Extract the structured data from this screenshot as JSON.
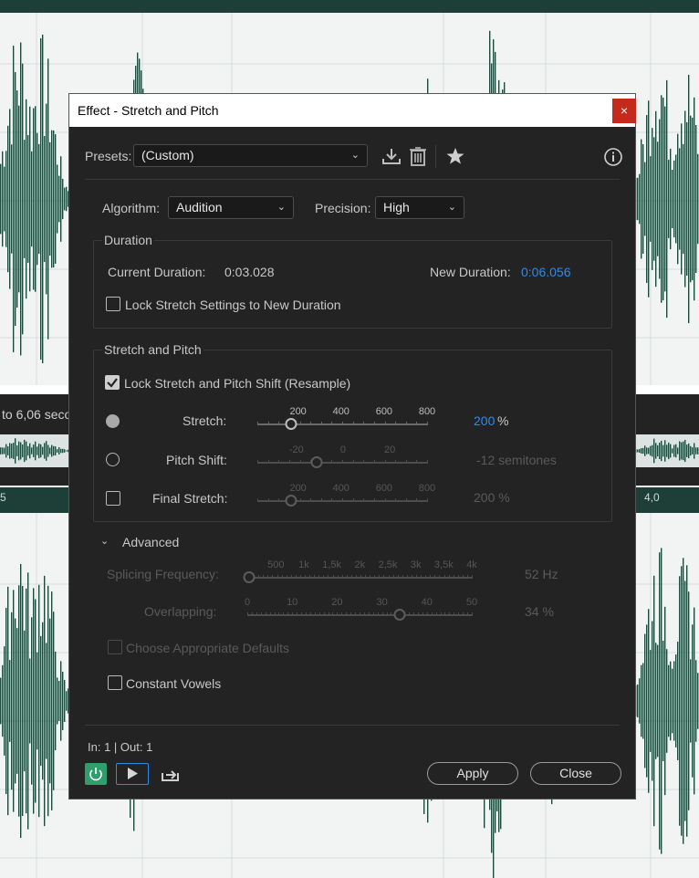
{
  "background": {
    "left_time_label": "to 6,06 seco",
    "ruler_left": "5",
    "ruler_right": "4,0",
    "colors": {
      "waveform": "#1e4a3e",
      "ruler": "#1d3f37"
    }
  },
  "dialog": {
    "title": "Effect - Stretch and Pitch",
    "close_glyph": "×",
    "presets": {
      "label": "Presets:",
      "value": "(Custom)"
    },
    "toolbar_icons": [
      "download-icon",
      "trash-icon",
      "star-icon",
      "info-icon"
    ],
    "algorithm": {
      "label": "Algorithm:",
      "value": "Audition"
    },
    "precision": {
      "label": "Precision:",
      "value": "High"
    },
    "duration": {
      "title": "Duration",
      "current_label": "Current Duration:",
      "current_value": "0:03.028",
      "new_label": "New Duration:",
      "new_value": "0:06.056",
      "lock_label": "Lock Stretch Settings to New Duration",
      "lock_checked": false
    },
    "stretch_pitch": {
      "title": "Stretch and Pitch",
      "lock_label": "Lock Stretch and Pitch Shift (Resample)",
      "lock_checked": true,
      "stretch": {
        "label": "Stretch:",
        "ticks": [
          "200",
          "400",
          "600",
          "800"
        ],
        "value": "200",
        "unit": "%",
        "level": 0.2
      },
      "pitch": {
        "label": "Pitch Shift:",
        "ticks": [
          "-20",
          "0",
          "20"
        ],
        "value": "-12 semitones",
        "level": 0.35
      },
      "final": {
        "label": "Final Stretch:",
        "ticks": [
          "200",
          "400",
          "600",
          "800"
        ],
        "value": "200 %",
        "level": 0.2
      }
    },
    "advanced": {
      "label": "Advanced",
      "splicing": {
        "label": "Splicing Frequency:",
        "ticks": [
          "500",
          "1k",
          "1,5k",
          "2k",
          "2,5k",
          "3k",
          "3,5k",
          "4k"
        ],
        "value": "52 Hz",
        "level": 0.0
      },
      "overlapping": {
        "label": "Overlapping:",
        "ticks": [
          "0",
          "10",
          "20",
          "30",
          "40",
          "50"
        ],
        "value": "34 %",
        "level": 0.68
      },
      "defaults_label": "Choose Appropriate Defaults",
      "vowels_label": "Constant Vowels"
    },
    "io_label": "In: 1 | Out: 1",
    "apply_label": "Apply",
    "close_label": "Close",
    "accent_color": "#2d8ceb"
  }
}
